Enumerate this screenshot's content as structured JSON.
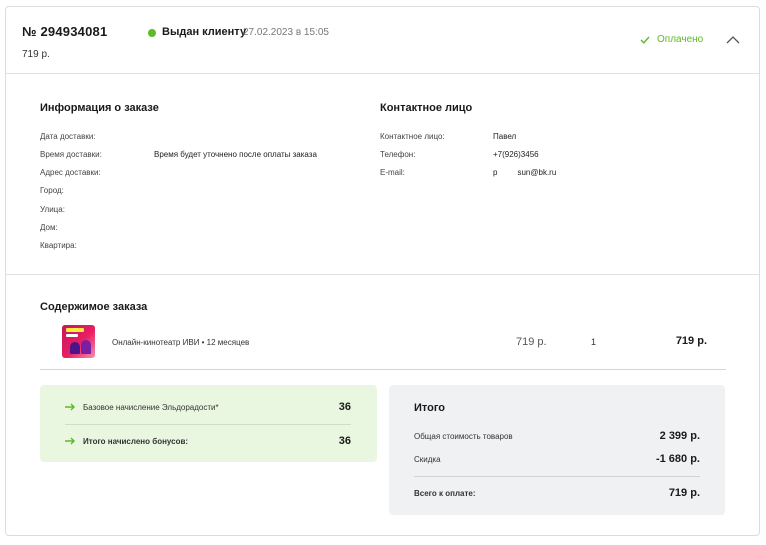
{
  "header": {
    "order_number": "№ 294934081",
    "order_price": "719 р.",
    "status_label": "Выдан клиенту",
    "status_date": "27.02.2023 в 15:05",
    "payment_status": "Оплачено",
    "status_color": "#5fb928"
  },
  "order_info": {
    "title": "Информация о заказе",
    "fields": [
      {
        "label": "Дата доставки:",
        "value": ""
      },
      {
        "label": "Время доставки:",
        "value": "Время будет уточнено после оплаты заказа"
      },
      {
        "label": "Адрес доставки:",
        "value": ""
      },
      {
        "label": "Город:",
        "value": ""
      },
      {
        "label": "Улица:",
        "value": ""
      },
      {
        "label": "Дом:",
        "value": ""
      },
      {
        "label": "Квартира:",
        "value": ""
      }
    ]
  },
  "contact": {
    "title": "Контактное лицо",
    "fields": [
      {
        "label": "Контактное лицо:",
        "value": "Павел"
      },
      {
        "label": "Телефон:",
        "value": "+7(926)3456"
      },
      {
        "label": "E-mail:",
        "value_prefix": "р",
        "value_suffix": "sun@bk.ru"
      }
    ]
  },
  "contents": {
    "title": "Содержимое заказа",
    "items": [
      {
        "name": "Онлайн-кинотеатр ИВИ • 12 месяцев",
        "price": "719 р.",
        "qty": "1",
        "total": "719 р.",
        "thumb_icon": "ivi-subscription-image"
      }
    ]
  },
  "bonus": {
    "rows": [
      {
        "label": "Базовое начисление Эльдорадости*",
        "value": "36",
        "bold": false
      },
      {
        "label": "Итого начислено бонусов:",
        "value": "36",
        "bold": true
      }
    ],
    "icon": "bonus-arrow-icon",
    "bg_color": "#eaf7e0"
  },
  "totals": {
    "title": "Итого",
    "rows": [
      {
        "label": "Общая стоимость товаров",
        "value": "2 399 р."
      },
      {
        "label": "Скидка",
        "value": "-1 680 р."
      }
    ],
    "grand_label": "Всего к оплате:",
    "grand_value": "719 р."
  }
}
